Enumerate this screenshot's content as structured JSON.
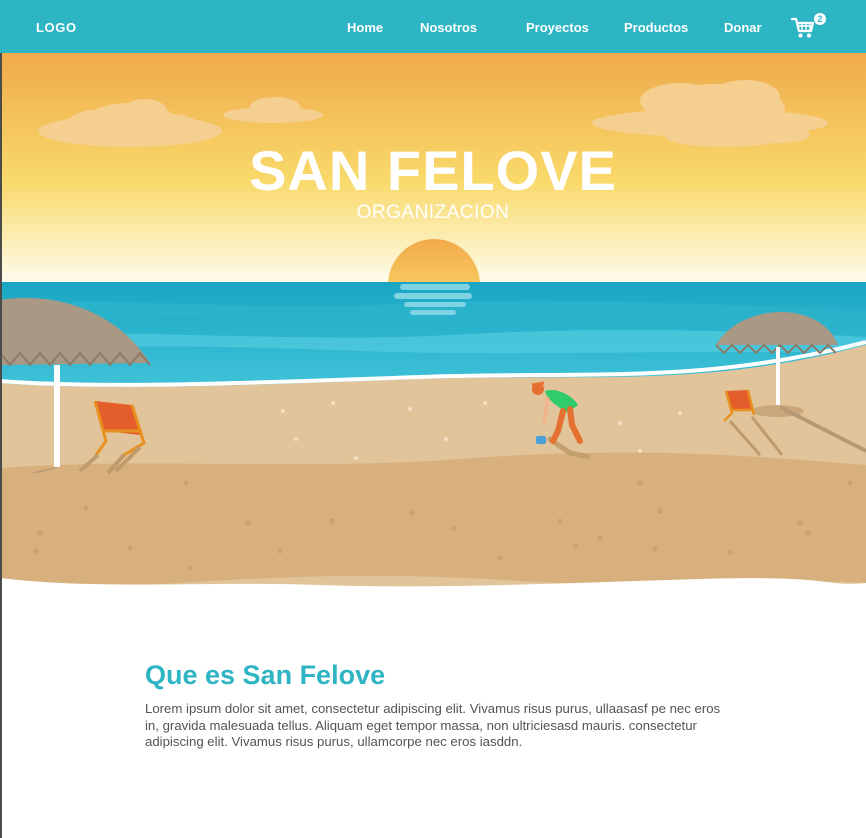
{
  "colors": {
    "brand": "#2eb5c4",
    "sky_top": "#efaa4c",
    "sea": "#2eb5c4",
    "sand": "#d8b07e",
    "text": "#545454"
  },
  "navbar": {
    "logo": "LOGO",
    "items": [
      {
        "label": "Home"
      },
      {
        "label": "Nosotros"
      },
      {
        "label": "Proyectos"
      },
      {
        "label": "Productos"
      },
      {
        "label": "Donar"
      }
    ],
    "cart": {
      "icon": "shopping-cart-icon",
      "count": "2"
    }
  },
  "hero": {
    "title": "SAN FELOVE",
    "subtitle": "ORGANIZACION"
  },
  "about": {
    "heading": "Que es San Felove",
    "body": "Lorem ipsum dolor sit amet, consectetur adipiscing elit. Vivamus risus purus, ullaasasf pe nec eros in, gravida malesuada tellus. Aliquam eget tempor massa, non ultriciesasd mauris. consectetur adipiscing elit. Vivamus risus purus, ullamcorpe nec eros iasddn."
  }
}
